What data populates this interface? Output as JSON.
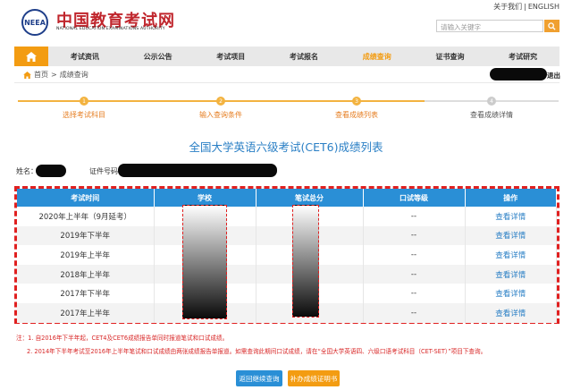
{
  "header": {
    "logo_emblem": "NEEA",
    "logo_title": "中国教育考试网",
    "logo_subtitle": "NATIONAL EDUCATION EXAMINATIONS AUTHORITY",
    "links": [
      "关于我们",
      "ENGLISH"
    ],
    "search_placeholder": "请输入关键字"
  },
  "nav": {
    "items": [
      "考试资讯",
      "公示公告",
      "考试项目",
      "考试报名",
      "成绩查询",
      "证书查询",
      "考试研究"
    ],
    "active_index": 4,
    "accent": "#f39c12"
  },
  "breadcrumb": {
    "home": "首页",
    "sep": ">",
    "current": "成绩查询"
  },
  "logout": "退出",
  "steps": [
    {
      "num": "1",
      "label": "选择考试科目"
    },
    {
      "num": "2",
      "label": "输入查询条件"
    },
    {
      "num": "3",
      "label": "查看成绩列表"
    },
    {
      "num": "4",
      "label": "查看成绩详情"
    }
  ],
  "page_title": "全国大学英语六级考试(CET6)成绩列表",
  "info": {
    "name_label": "姓名：",
    "cert_label": "证件号码："
  },
  "table": {
    "columns": [
      "考试时间",
      "学校",
      "笔试总分",
      "口试等级",
      "操作"
    ],
    "rows": [
      {
        "time": "2020年上半年（9月延考）",
        "oral": "--",
        "action": "查看详情"
      },
      {
        "time": "2019年下半年",
        "oral": "--",
        "action": "查看详情"
      },
      {
        "time": "2019年上半年",
        "oral": "--",
        "action": "查看详情"
      },
      {
        "time": "2018年上半年",
        "oral": "--",
        "action": "查看详情"
      },
      {
        "time": "2017年下半年",
        "oral": "--",
        "action": "查看详情"
      },
      {
        "time": "2017年上半年",
        "oral": "--",
        "action": "查看详情"
      }
    ]
  },
  "notes": [
    "注：1. 自2016年下半年起，CET4及CET6成绩报告单同时报道笔试和口试成绩。",
    "2. 2014年下半年考试至2016年上半年笔试和口试成绩由两张成绩报告单报道。如需查询此期间口试成绩，请在“全国大学英语四、六级口语考试科目（CET-SET）”项目下查询。"
  ],
  "buttons": {
    "back": "返回继续查询",
    "certificate": "补办成绩证明书",
    "back_color": "#2a8fd6",
    "certificate_color": "#f39c12"
  }
}
